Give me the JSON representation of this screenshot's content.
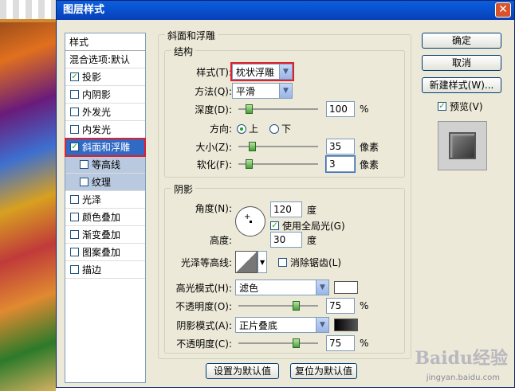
{
  "window": {
    "title": "图层样式",
    "close_glyph": "✕"
  },
  "left_panel": {
    "header": "样式",
    "blend_options": "混合选项:默认",
    "items": [
      {
        "label": "投影",
        "checked": true
      },
      {
        "label": "内阴影",
        "checked": false
      },
      {
        "label": "外发光",
        "checked": false
      },
      {
        "label": "内发光",
        "checked": false
      },
      {
        "label": "斜面和浮雕",
        "checked": true
      },
      {
        "label": "等高线",
        "checked": false
      },
      {
        "label": "纹理",
        "checked": false
      },
      {
        "label": "光泽",
        "checked": false
      },
      {
        "label": "颜色叠加",
        "checked": false
      },
      {
        "label": "渐变叠加",
        "checked": false
      },
      {
        "label": "图案叠加",
        "checked": false
      },
      {
        "label": "描边",
        "checked": false
      }
    ],
    "check_glyph": "✓"
  },
  "bevel": {
    "group_title": "斜面和浮雕",
    "structure_title": "结构",
    "style_label": "样式(T):",
    "style_value": "枕状浮雕",
    "technique_label": "方法(Q):",
    "technique_value": "平滑",
    "depth_label": "深度(D):",
    "depth_value": "100",
    "depth_unit": "%",
    "depth_fraction": 0.1,
    "direction_label": "方向:",
    "direction_up": "上",
    "direction_down": "下",
    "size_label": "大小(Z):",
    "size_value": "35",
    "size_unit": "像素",
    "size_fraction": 0.14,
    "soften_label": "软化(F):",
    "soften_value": "3",
    "soften_unit": "像素",
    "soften_fraction": 0.1
  },
  "shading": {
    "group_title": "阴影",
    "angle_label": "角度(N):",
    "angle_value": "120",
    "angle_unit": "度",
    "global_light_label": "使用全局光(G)",
    "global_light_checked": true,
    "altitude_label": "高度:",
    "altitude_value": "30",
    "altitude_unit": "度",
    "gloss_contour_label": "光泽等高线:",
    "anti_alias_label": "消除锯齿(L)",
    "highlight_mode_label": "高光模式(H):",
    "highlight_mode_value": "滤色",
    "highlight_opacity_label": "不透明度(O):",
    "highlight_opacity_value": "75",
    "highlight_opacity_fraction": 0.75,
    "shadow_mode_label": "阴影模式(A):",
    "shadow_mode_value": "正片叠底",
    "shadow_opacity_label": "不透明度(C):",
    "shadow_opacity_value": "75",
    "shadow_opacity_fraction": 0.75,
    "percent": "%",
    "highlight_color": "#ffffff",
    "shadow_color": "#000000"
  },
  "bottom_buttons": {
    "set_default": "设置为默认值",
    "reset_default": "复位为默认值"
  },
  "right_panel": {
    "ok": "确定",
    "cancel": "取消",
    "new_style": "新建样式(W)...",
    "preview_label": "预览(V)",
    "preview_checked": true
  },
  "watermark": {
    "brand": "Baidu经验",
    "url": "jingyan.baidu.com"
  },
  "colors": {
    "accent": "#316ac5",
    "highlight_border": "#e0202a",
    "titlebar": "#0a5fe0"
  }
}
